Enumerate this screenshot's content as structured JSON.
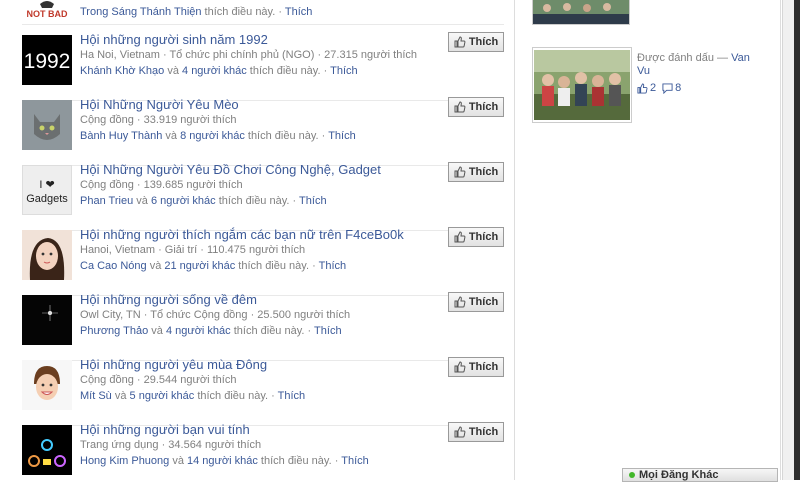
{
  "top_row": {
    "logo_text": "NOT BAD",
    "liker": "Trong Sáng Thánh Thiện",
    "suffix": " thích điều này.",
    "like_link": "Thích"
  },
  "like_button_label": "Thích",
  "pages": [
    {
      "thumb": "1992",
      "title": "Hội những người sinh năm 1992",
      "sub": "Ha Noi, Vietnam · Tổ chức phi chính phủ (NGO) · 27.315 người thích",
      "liker": "Khánh Khờ Khạo",
      "and": " và ",
      "others": "4 người khác",
      "suffix": " thích điều này. · ",
      "like_link": "Thích"
    },
    {
      "thumb": "",
      "title": "Hội Những Người Yêu Mèo",
      "sub": "Cộng đồng · 33.919 người thích",
      "liker": "Bành Huy Thành",
      "and": " và ",
      "others": "8 người khác",
      "suffix": " thích điều này. · ",
      "like_link": "Thích"
    },
    {
      "thumb": "I ❤ Gadgets",
      "title": "Hội Những Người Yêu Đồ Chơi Công Nghệ, Gadget",
      "sub": "Cộng đồng · 139.685 người thích",
      "liker": "Phan Trieu",
      "and": " và ",
      "others": "6 người khác",
      "suffix": " thích điều này. · ",
      "like_link": "Thích"
    },
    {
      "thumb": "",
      "title": "Hội những người thích ngắm các bạn nữ trên F4ceBo0k",
      "sub": "Hanoi, Vietnam · Giải trí · 110.475 người thích",
      "liker": "Ca Cao Nóng",
      "and": " và ",
      "others": "21 người khác",
      "suffix": " thích điều này. · ",
      "like_link": "Thích"
    },
    {
      "thumb": "",
      "title": "Hội những người sống về đêm",
      "sub": "Owl City, TN · Tổ chức Cộng đồng · 25.500 người thích",
      "liker": "Phương Thảo",
      "and": " và ",
      "others": "4 người khác",
      "suffix": " thích điều này. · ",
      "like_link": "Thích"
    },
    {
      "thumb": "",
      "title": "Hội những người yêu mùa Đông",
      "sub": "Cộng đồng · 29.544 người thích",
      "liker": "Mít Sù",
      "and": " và ",
      "others": "5 người khác",
      "suffix": " thích điều này. · ",
      "like_link": "Thích"
    },
    {
      "thumb": "",
      "title": "Hội những người bạn vui tính",
      "sub": "Trang ứng dụng · 34.564 người thích",
      "liker": "Hong Kim Phuong",
      "and": " và ",
      "others": "14 người khác",
      "suffix": " thích điều này. · ",
      "like_link": "Thích"
    }
  ],
  "right": {
    "caption_prefix": "Được đánh dấu — ",
    "caption_name": "Van Vu",
    "likes_count": "2",
    "comments_count": "8"
  },
  "chat": {
    "label": "Mọi Đăng Khác"
  },
  "colors": {
    "link": "#3b5998",
    "muted": "#808080",
    "online": "#42b72a"
  }
}
